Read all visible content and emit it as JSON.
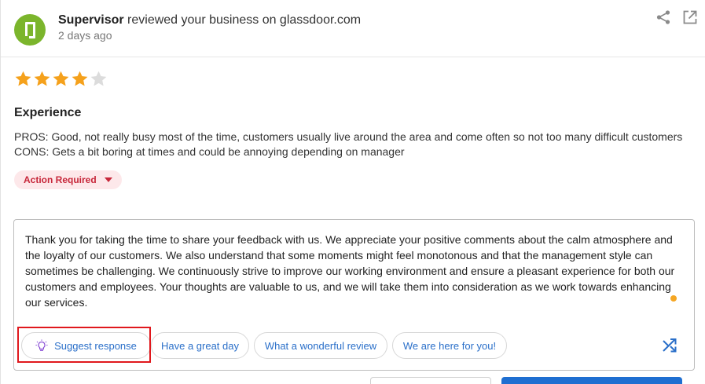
{
  "header": {
    "reviewer": "Supervisor",
    "action_text": "reviewed your business on glassdoor.com",
    "time": "2 days ago",
    "icons": {
      "avatar": "glassdoor-logo-icon",
      "share": "share-icon",
      "open": "open-external-icon"
    }
  },
  "rating": {
    "value": 4,
    "max": 5,
    "filled_color": "#f5a11c",
    "empty_color": "#dcdcdc"
  },
  "review": {
    "title": "Experience",
    "pros": "PROS: Good, not really busy most of the time, customers usually live around the area and come often so not too many difficult customers",
    "cons": "CONS: Gets a bit boring at times and could be annoying depending on manager"
  },
  "status": {
    "label": "Action Required",
    "color": "#c7273a",
    "background": "#fde8ea"
  },
  "response": {
    "text": "Thank you for taking the time to share your feedback with us. We appreciate your positive comments about the calm atmosphere and the loyalty of our customers. We also understand that some moments might feel monotonous and that the management style can sometimes be challenging. We continuously strive to improve our working environment and ensure a pleasant experience for both our customers and employees. Your thoughts are valuable to us, and we will take them into consideration as we work towards enhancing our services."
  },
  "suggestions": {
    "suggest_label": "Suggest response",
    "chip_1": "Have a great day",
    "chip_2": "What a wonderful review",
    "chip_3": "We are here for you!",
    "accent_color": "#2a6fc9"
  },
  "highlight": {
    "color": "#e0181d"
  }
}
